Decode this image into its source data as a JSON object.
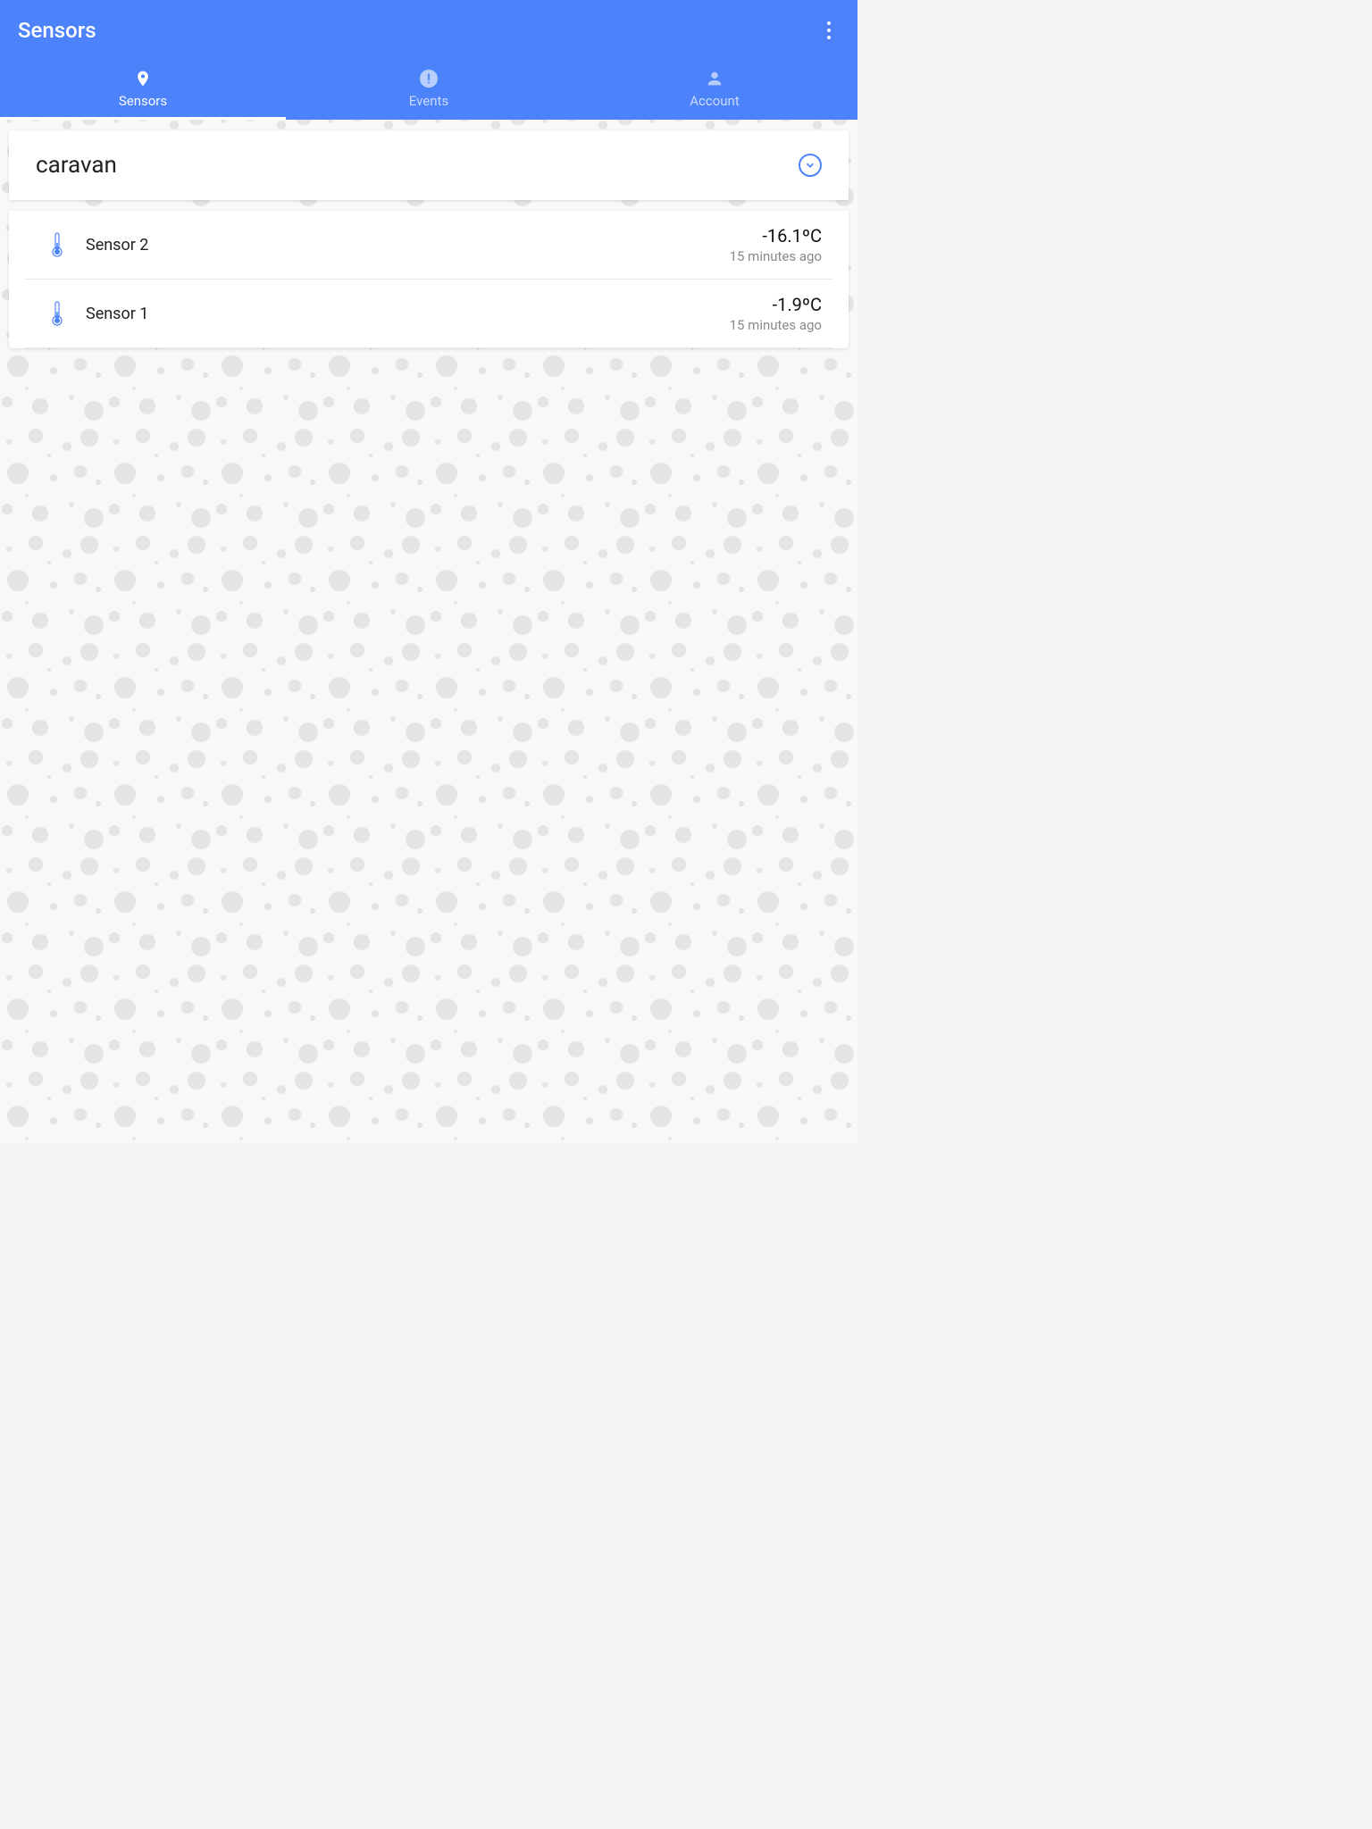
{
  "header": {
    "title": "Sensors"
  },
  "tabs": {
    "sensors": {
      "label": "Sensors"
    },
    "events": {
      "label": "Events"
    },
    "account": {
      "label": "Account"
    }
  },
  "group": {
    "title": "caravan"
  },
  "sensors": [
    {
      "name": "Sensor 2",
      "value": "-16.1ºC",
      "time": "15 minutes ago"
    },
    {
      "name": "Sensor 1",
      "value": "-1.9ºC",
      "time": "15 minutes ago"
    }
  ]
}
